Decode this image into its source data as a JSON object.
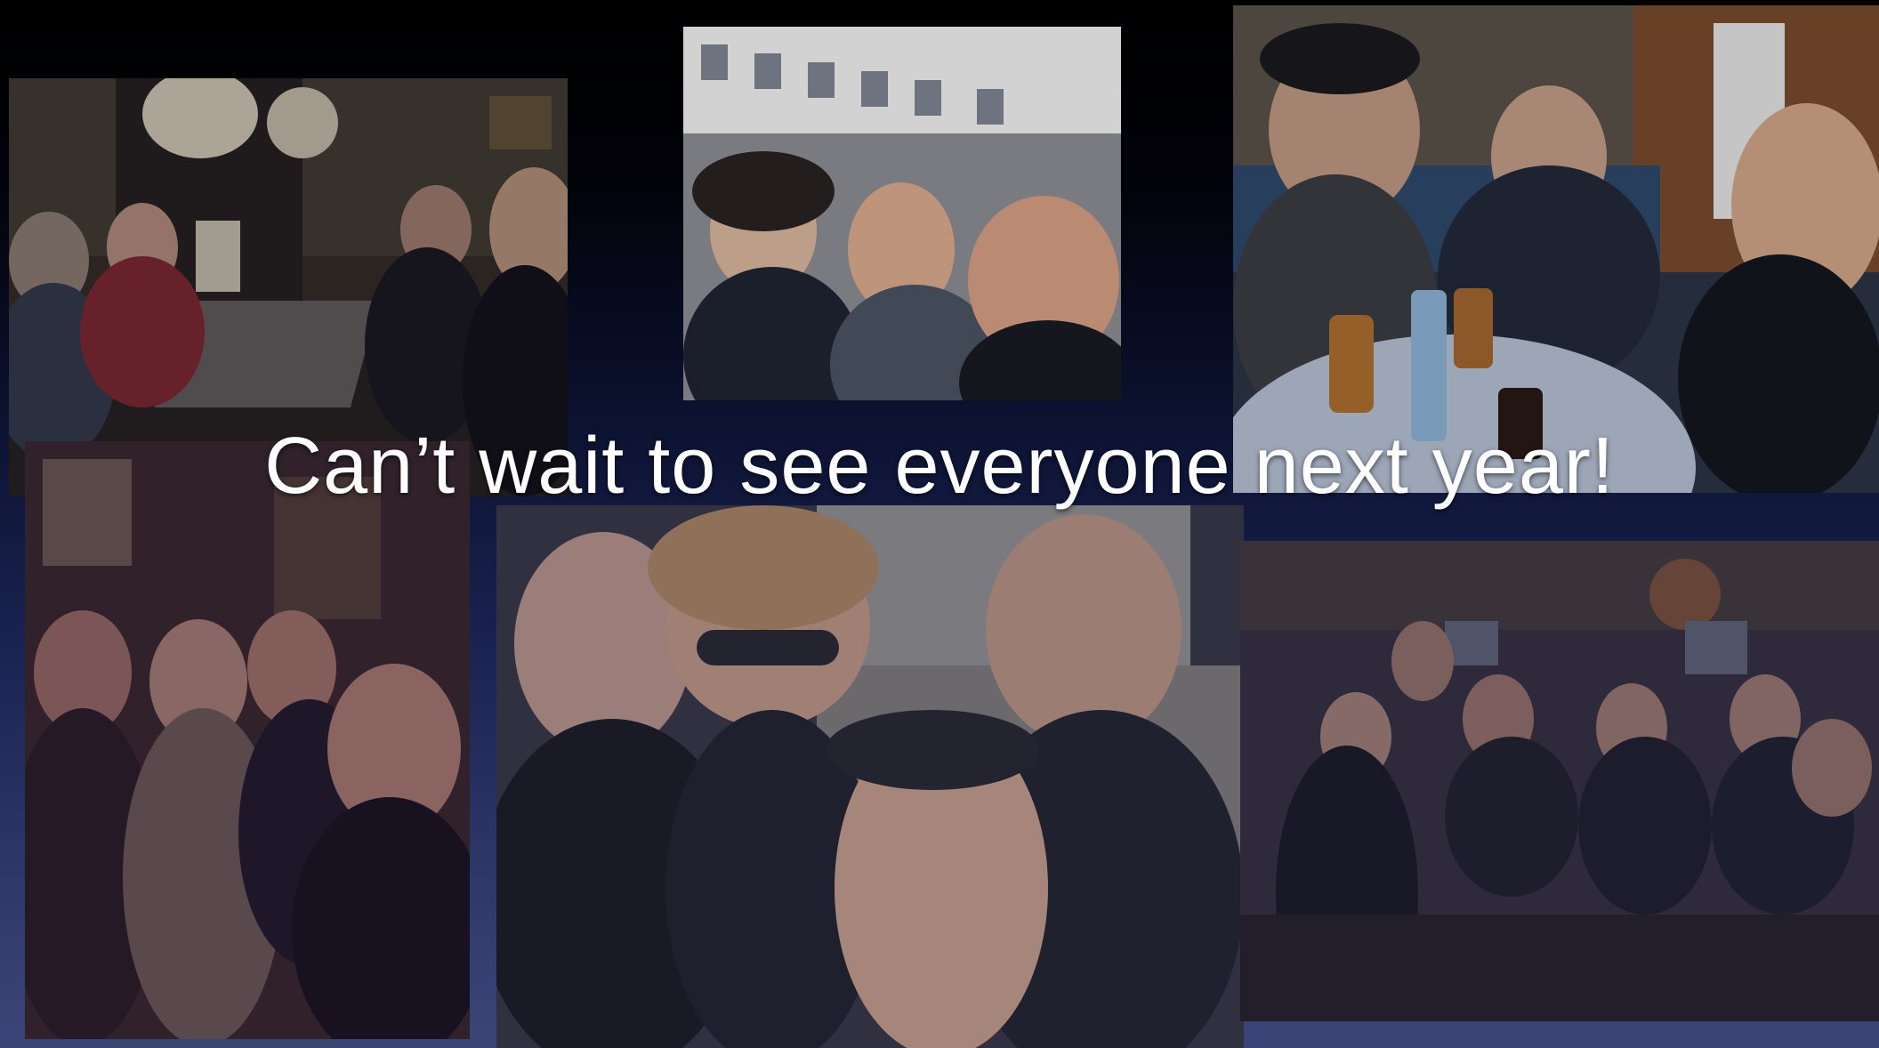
{
  "slide": {
    "caption": "Can’t wait to see everyone next year!"
  },
  "colors": {
    "caption": "#ffffff",
    "background_top": "#000000",
    "background_bottom": "#3c4577"
  }
}
